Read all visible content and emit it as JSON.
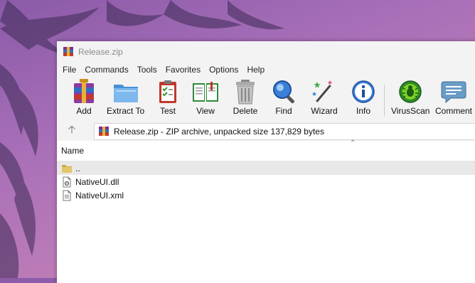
{
  "window": {
    "title": "Release.zip"
  },
  "menu": [
    "File",
    "Commands",
    "Tools",
    "Favorites",
    "Options",
    "Help"
  ],
  "toolbar": [
    {
      "label": "Add",
      "icon": "add-archive-icon"
    },
    {
      "label": "Extract To",
      "icon": "extract-folder-icon"
    },
    {
      "label": "Test",
      "icon": "test-clipboard-icon"
    },
    {
      "label": "View",
      "icon": "view-book-icon"
    },
    {
      "label": "Delete",
      "icon": "trash-icon"
    },
    {
      "label": "Find",
      "icon": "magnifier-icon"
    },
    {
      "label": "Wizard",
      "icon": "magic-wand-icon"
    },
    {
      "label": "Info",
      "icon": "info-icon"
    },
    {
      "label": "VirusScan",
      "icon": "virus-scan-icon"
    },
    {
      "label": "Comment",
      "icon": "comment-icon"
    }
  ],
  "address": {
    "text": "Release.zip - ZIP archive, unpacked size 137,829 bytes"
  },
  "columns": {
    "name": "Name"
  },
  "files": [
    {
      "name": "..",
      "icon": "parent-folder-icon"
    },
    {
      "name": "NativeUI.dll",
      "icon": "dll-file-icon"
    },
    {
      "name": "NativeUI.xml",
      "icon": "xml-file-icon"
    }
  ],
  "colors": {
    "background": "#a86fb8",
    "toolbar": "#f3f3f3",
    "selected_row": "#e8e8e8"
  }
}
